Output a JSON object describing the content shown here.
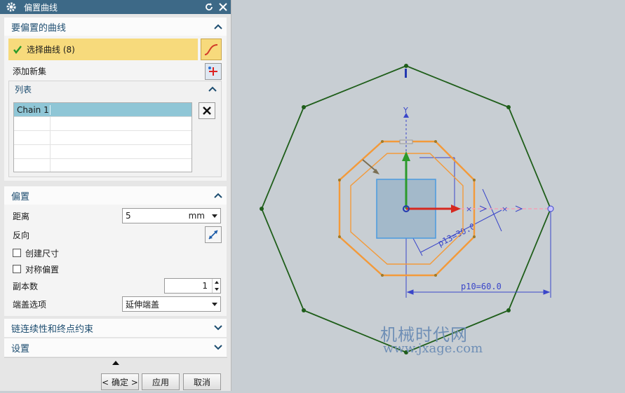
{
  "dialog": {
    "title": "偏置曲线",
    "curves_section": {
      "header": "要偏置的曲线",
      "select_label": "选择曲线 (8)",
      "add_set_label": "添加新集",
      "list": {
        "header": "列表",
        "rows": [
          "Chain 1"
        ]
      }
    },
    "offset_section": {
      "header": "偏置",
      "distance_label": "距离",
      "distance_value": "5",
      "distance_unit": "mm",
      "reverse_label": "反向",
      "create_dim_label": "创建尺寸",
      "symmetric_label": "对称偏置",
      "copies_label": "副本数",
      "copies_value": "1",
      "endcap_label": "端盖选项",
      "endcap_value": "延伸端盖"
    },
    "chain_section": {
      "header": "链连续性和终点约束"
    },
    "settings_section": {
      "header": "设置"
    },
    "buttons": {
      "ok": "< 确定 >",
      "apply": "应用",
      "cancel": "取消"
    }
  },
  "canvas": {
    "axis_label": "Y",
    "dim_outer": "p10=60.0",
    "dim_inner": "p13=30.0",
    "watermark_cn": "机械时代网",
    "watermark_url": "www.jxage.com"
  },
  "colors": {
    "title_bar": "#3d6987",
    "selection_highlight": "#f7da7c",
    "outer_octagon": "#1f5e1a",
    "offset_curve": "#f39a3a",
    "dimension": "#3a46c9"
  }
}
